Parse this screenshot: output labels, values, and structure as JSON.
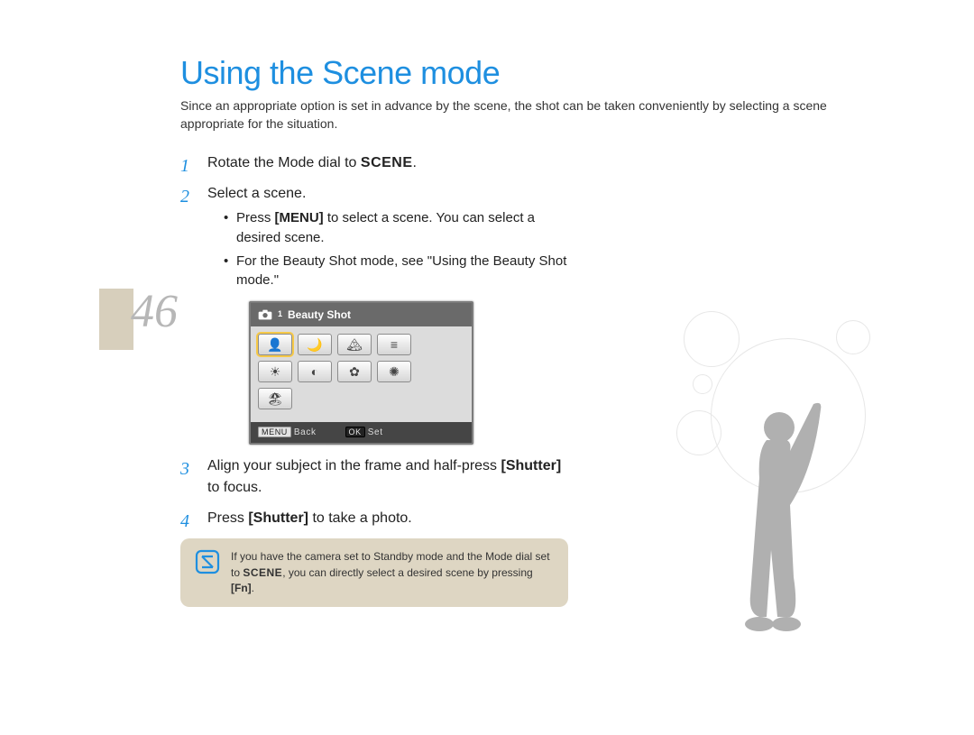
{
  "page_number": "46",
  "title": "Using the Scene mode",
  "lead": "Since an appropriate option is set in advance by the scene, the shot can be taken conveniently by selecting a scene appropriate for the situation.",
  "steps": {
    "s1_num": "1",
    "s1_prefix": "Rotate the Mode dial to ",
    "s1_label": "SCENE",
    "s1_suffix": ".",
    "s2_num": "2",
    "s2_text": "Select a scene.",
    "s2_b1_a": "Press ",
    "s2_b1_key": "[MENU]",
    "s2_b1_b": " to select a scene. You can select a desired scene.",
    "s2_b2": "For the Beauty Shot mode, see \"Using the Beauty Shot mode.\"",
    "s3_num": "3",
    "s3_a": "Align your subject in the frame and half-press ",
    "s3_key": "[Shutter]",
    "s3_b": " to focus.",
    "s4_num": "4",
    "s4_a": "Press ",
    "s4_key": "[Shutter]",
    "s4_b": " to take a photo."
  },
  "lcd": {
    "header_subscript": "1",
    "header_title": "Beauty Shot",
    "footer_menu": "MENU",
    "footer_back": "Back",
    "footer_ok": "OK",
    "footer_set": "Set"
  },
  "note": {
    "a": "If you have the camera set to Standby mode and the Mode dial set to ",
    "scene": "SCENE",
    "b": ", you can directly select a desired scene by pressing ",
    "fn": "[Fn]",
    "c": "."
  },
  "icons": {
    "note": "note-icon",
    "camera": "camera-icon"
  }
}
